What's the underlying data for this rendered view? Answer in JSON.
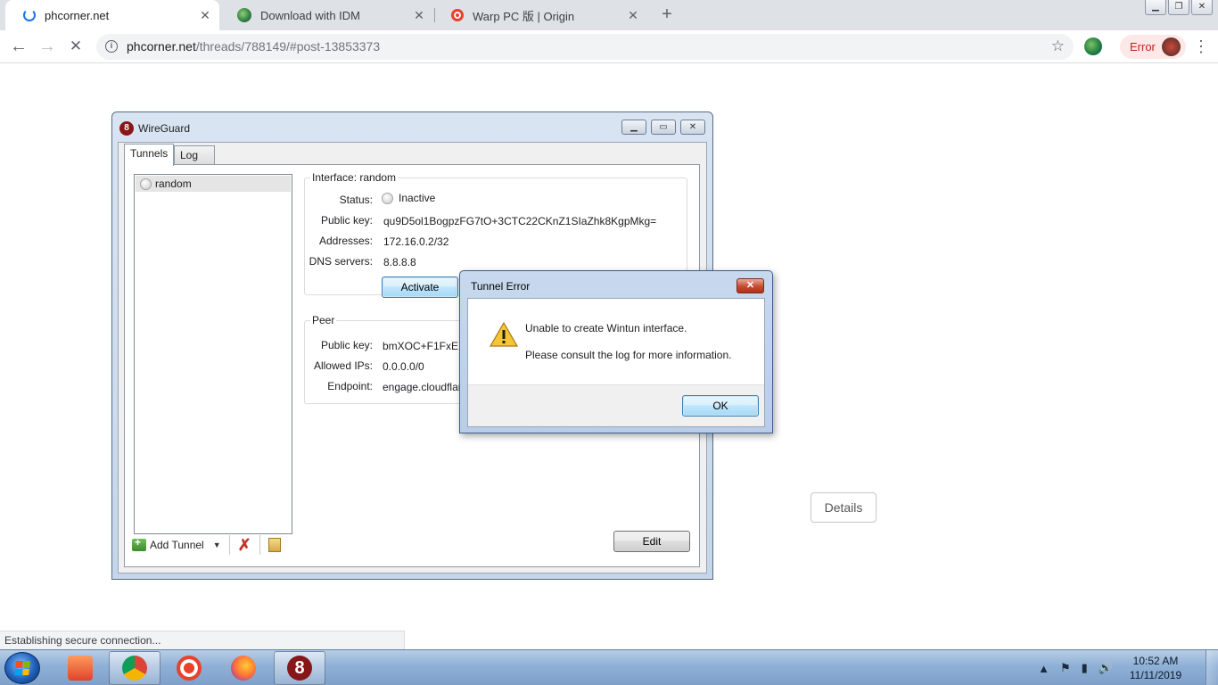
{
  "browser": {
    "tabs": [
      {
        "title": "phcorner.net",
        "icon": "loading-spinner-icon",
        "active": true
      },
      {
        "title": "Download with IDM",
        "icon": "idm-globe-icon",
        "active": false
      },
      {
        "title": "Warp PC 版 | Origin",
        "icon": "origin-icon",
        "active": false
      }
    ],
    "url_host": "phcorner.net",
    "url_path": "/threads/788149/#post-13853373",
    "profile_status": "Error",
    "status_text": "Establishing secure connection..."
  },
  "wireguard": {
    "window_title": "WireGuard",
    "tabs": [
      "Tunnels",
      "Log"
    ],
    "tunnels": [
      {
        "name": "random"
      }
    ],
    "interface": {
      "legend": "Interface: random",
      "status_label": "Status:",
      "status_value": "Inactive",
      "pubkey_label": "Public key:",
      "pubkey_value": "qu9D5ol1BogpzFG7tO+3CTC22CKnZ1SIaZhk8KgpMkg=",
      "addresses_label": "Addresses:",
      "addresses_value": "172.16.0.2/32",
      "dns_label": "DNS servers:",
      "dns_value": "8.8.8.8",
      "activate_label": "Activate"
    },
    "peer": {
      "legend": "Peer",
      "pubkey_label": "Public key:",
      "pubkey_value": "bmXOC+F1FxEM",
      "allowed_label": "Allowed IPs:",
      "allowed_value": "0.0.0.0/0",
      "endpoint_label": "Endpoint:",
      "endpoint_value": "engage.cloudflar"
    },
    "add_tunnel_label": "Add Tunnel",
    "edit_label": "Edit"
  },
  "dialog": {
    "title": "Tunnel Error",
    "line1": "Unable to create Wintun interface.",
    "line2": "Please consult the log for more information.",
    "ok_label": "OK"
  },
  "page": {
    "details_label": "Details"
  },
  "taskbar": {
    "apps": [
      "media-player-icon",
      "chrome-icon",
      "origin-icon",
      "firefox-icon",
      "wireguard-icon"
    ],
    "time": "10:52 AM",
    "date": "11/11/2019"
  },
  "colors": {
    "wireguard_red": "#88171a",
    "error_text": "#c5221f",
    "error_bg": "#fce8e6"
  }
}
